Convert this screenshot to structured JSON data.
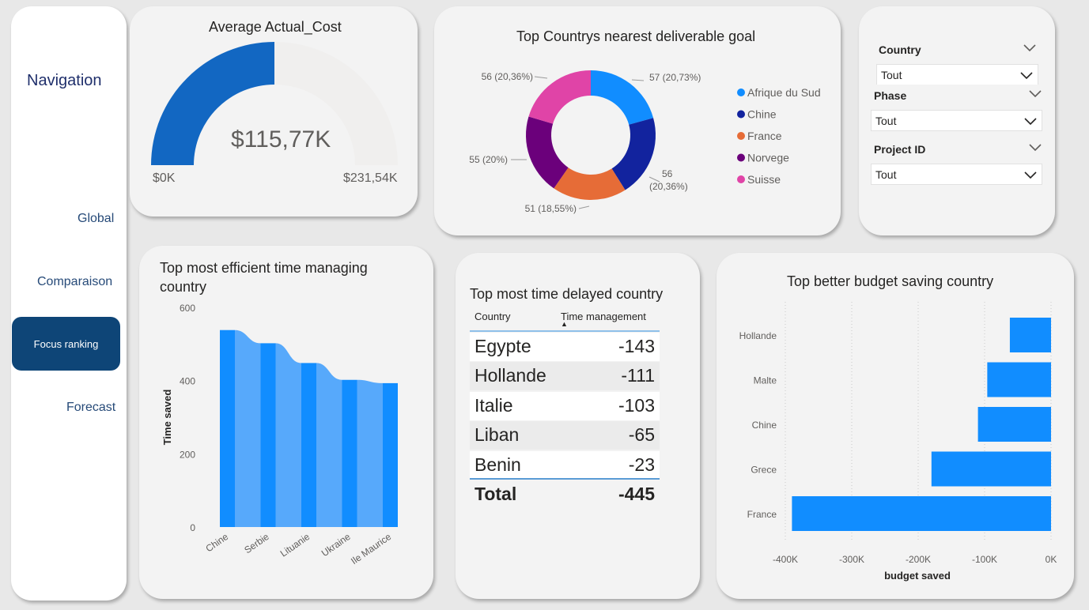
{
  "navigation": {
    "title": "Navigation",
    "links": {
      "global": "Global",
      "comparaison": "Comparaison",
      "focus": "Focus ranking",
      "forecast": "Forecast"
    }
  },
  "gauge": {
    "title": "Average Actual_Cost",
    "value_label": "$115,77K",
    "min_label": "$0K",
    "max_label": "$231,54K",
    "chart_data": {
      "type": "gauge",
      "value": 115.77,
      "min": 0,
      "max": 231.54,
      "unit": "K$",
      "fill_color": "#1267c2",
      "track_color": "#f0efee"
    }
  },
  "donut": {
    "title": "Top Countrys nearest deliverable goal",
    "chart_data": {
      "type": "pie",
      "labels": [
        "Afrique du Sud",
        "Chine",
        "France",
        "Norvege",
        "Suisse"
      ],
      "values": [
        57,
        56,
        51,
        55,
        56
      ],
      "percent_labels": [
        "57 (20,73%)",
        "56 (20,36%)",
        "51 (18,55%)",
        "55 (20%)",
        "56 (20,36%)"
      ],
      "colors": [
        "#118dff",
        "#12239e",
        "#e66c37",
        "#6b007b",
        "#e044a7"
      ],
      "legend_position": "right"
    }
  },
  "slicers": {
    "country": {
      "label": "Country",
      "value": "Tout"
    },
    "phase": {
      "label": "Phase",
      "value": "Tout"
    },
    "project": {
      "label": "Project ID",
      "value": "Tout"
    }
  },
  "area_chart": {
    "title_line1": "Top most efficient time managing",
    "title_line2": "country",
    "chart_data": {
      "type": "bar",
      "categories": [
        "Chine",
        "Serbie",
        "Lituanie",
        "Ukraine",
        "Ile Maurice"
      ],
      "values": [
        538,
        502,
        448,
        402,
        393
      ],
      "ylabel": "Time saved",
      "xlabel": "",
      "ylim": [
        0,
        600
      ],
      "yticks": [
        0,
        200,
        400,
        600
      ],
      "bar_color": "#118dff",
      "ribbon_color": "#57a9fb"
    }
  },
  "delay_table": {
    "title": "Top most time delayed country",
    "headers": [
      "Country",
      "Time management"
    ],
    "rows": [
      [
        "Egypte",
        "-143"
      ],
      [
        "Hollande",
        "-111"
      ],
      [
        "Italie",
        "-103"
      ],
      [
        "Liban",
        "-65"
      ],
      [
        "Benin",
        "-23"
      ]
    ],
    "total_label": "Total",
    "total_value": "-445",
    "sort_indicator": "▲"
  },
  "budget_chart": {
    "title": "Top better budget saving country",
    "chart_data": {
      "type": "bar",
      "orientation": "horizontal",
      "categories": [
        "Hollande",
        "Malte",
        "Chine",
        "Grece",
        "France"
      ],
      "values": [
        -62000,
        -96000,
        -110000,
        -180000,
        -390000
      ],
      "xlabel": "budget saved",
      "ylabel": "",
      "xlim": [
        -400000,
        0
      ],
      "xtick_labels": [
        "-400K",
        "-300K",
        "-200K",
        "-100K",
        "0K"
      ],
      "xtick_values": [
        -400000,
        -300000,
        -200000,
        -100000,
        0
      ],
      "grid": "vertical dotted",
      "bar_color": "#118dff"
    }
  }
}
